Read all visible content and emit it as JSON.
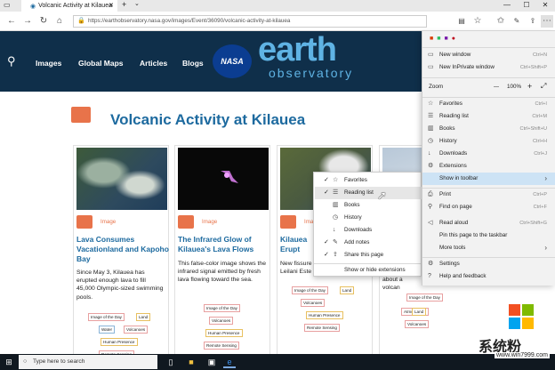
{
  "browser": {
    "tab_title": "Volcanic Activity at Kilauea",
    "url": "https://earthobservatory.nasa.gov/images/Event/36090/volcanic-activity-at-kilauea"
  },
  "site": {
    "nav": [
      "Images",
      "Global Maps",
      "Articles",
      "Blogs"
    ],
    "logo_badge": "NASA",
    "logo_main": "earth",
    "logo_sub": "observatory",
    "page_title": "Volcanic Activity at Kilauea"
  },
  "cards": [
    {
      "type": "Image",
      "title": "Lava Consumes Vacationland and Kapoho Bay",
      "desc": "Since May 3, Kilauea has erupted enough lava to fill 45,000 Olympic-sized swimming pools.",
      "tags": [
        "Image of the Day",
        "Land",
        "Water",
        "Volcanoes",
        "Human Presence",
        "Remote Sensing"
      ]
    },
    {
      "type": "Image",
      "title": "The Infrared Glow of Kilauea's Lava Flows",
      "desc": "This false-color image shows the infrared signal emitted by fresh lava flowing toward the sea.",
      "tags": [
        "Image of the Day",
        "Volcanoes",
        "Human Presence",
        "Remote Sensing"
      ]
    },
    {
      "type": "Image",
      "title": "Kilauea Erupt",
      "desc": "New fissure Leilani Este",
      "tags": [
        "Image of the Day",
        "Land",
        "Volcanoes",
        "Human Presence",
        "Remote Sensing"
      ]
    },
    {
      "type": "",
      "title": "",
      "desc": "about a volcan",
      "tags": [
        "Image of the Day",
        "Atmosphere",
        "Land",
        "Volcanoes"
      ]
    }
  ],
  "submenu": {
    "items": [
      "Favorites",
      "Reading list",
      "Books",
      "History",
      "Downloads",
      "Add notes",
      "Share this page",
      "Show or hide extensions"
    ]
  },
  "menu": {
    "new_window": "New window",
    "new_window_sc": "Ctrl+N",
    "new_inprivate": "New InPrivate window",
    "new_inprivate_sc": "Ctrl+Shift+P",
    "zoom_label": "Zoom",
    "zoom_minus": "—",
    "zoom_value": "100%",
    "zoom_plus": "+",
    "favorites": "Favorites",
    "favorites_sc": "Ctrl+I",
    "reading_list": "Reading list",
    "reading_list_sc": "Ctrl+M",
    "books": "Books",
    "books_sc": "Ctrl+Shift+U",
    "history": "History",
    "history_sc": "Ctrl+H",
    "downloads": "Downloads",
    "downloads_sc": "Ctrl+J",
    "extensions": "Extensions",
    "show_in_toolbar": "Show in toolbar",
    "print": "Print",
    "print_sc": "Ctrl+P",
    "find": "Find on page",
    "find_sc": "Ctrl+F",
    "read_aloud": "Read aloud",
    "read_aloud_sc": "Ctrl+Shift+G",
    "pin": "Pin this page to the taskbar",
    "more_tools": "More tools",
    "settings": "Settings",
    "help": "Help and feedback"
  },
  "taskbar": {
    "search_placeholder": "Type here to search"
  },
  "watermark": {
    "brand": "系统粉",
    "site": "www.win7999.com"
  }
}
